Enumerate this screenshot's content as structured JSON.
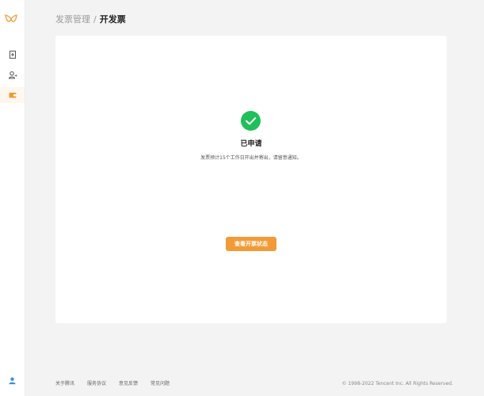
{
  "breadcrumb": {
    "parent": "发票管理",
    "separator": "/",
    "current": "开发票"
  },
  "sidebar": {
    "items": [
      {
        "icon": "document-add-icon"
      },
      {
        "icon": "person-switch-icon"
      },
      {
        "icon": "wallet-icon",
        "active": true
      }
    ],
    "user_icon": "user-icon"
  },
  "result": {
    "icon": "check-circle-icon",
    "title": "已申请",
    "description": "发票预计15个工作日开出并寄出，请留意通知。",
    "button_label": "查看开票状态"
  },
  "footer": {
    "links": [
      "关于腾讯",
      "服务协议",
      "意见反馈",
      "常见问题"
    ],
    "copyright": "© 1998-2022 Tencent Inc. All Rights Reserved."
  },
  "colors": {
    "accent": "#f29b36",
    "success": "#1fbf5a",
    "background": "#f3f3f4"
  }
}
